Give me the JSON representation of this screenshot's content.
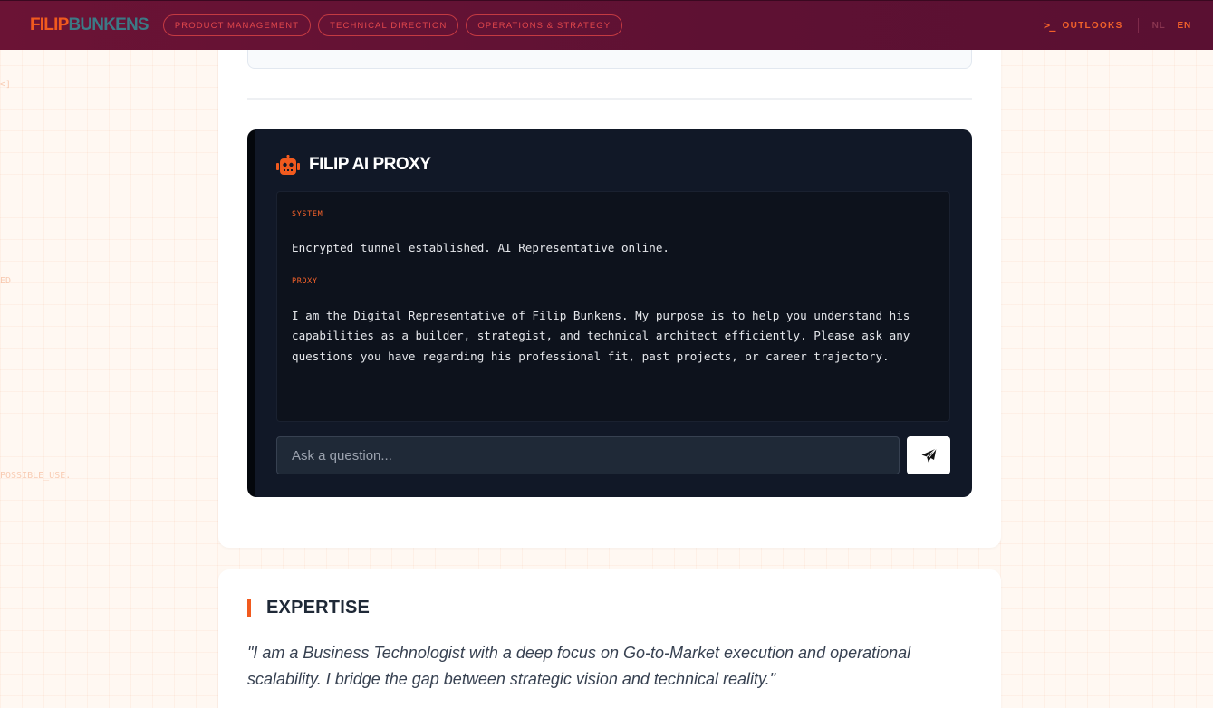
{
  "header": {
    "logo_first": "FILIP",
    "logo_last": "BUNKENS",
    "nav": [
      {
        "label": "PRODUCT MANAGEMENT"
      },
      {
        "label": "TECHNICAL DIRECTION"
      },
      {
        "label": "OPERATIONS & STRATEGY"
      }
    ],
    "outlooks_label": "OUTLOOKS",
    "outlooks_icon": "terminal-icon",
    "lang_nl": "NL",
    "lang_en": "EN"
  },
  "side_fragments": {
    "a": "<]",
    "b": "ED",
    "c": "POSSIBLE_USE."
  },
  "proxy": {
    "title": "FILIP AI PROXY",
    "icon": "robot-icon",
    "messages": [
      {
        "role": "SYSTEM",
        "text": "Encrypted tunnel established. AI Representative online."
      },
      {
        "role": "PROXY",
        "text": "I am the Digital Representative of Filip Bunkens. My purpose is to help you understand his capabilities as a builder, strategist, and technical architect efficiently. Please ask any questions you have regarding his professional fit, past projects, or career trajectory."
      }
    ],
    "input_placeholder": "Ask a question...",
    "send_icon": "send-icon"
  },
  "expertise": {
    "title": "EXPERTISE",
    "quote": "\"I am a Business Technologist with a deep focus on Go-to-Market execution and operational scalability. I bridge the gap between strategic vision and technical reality.\""
  },
  "colors": {
    "accent": "#f15a1e",
    "header_bg": "#5e1133",
    "panel_bg": "#111827"
  }
}
